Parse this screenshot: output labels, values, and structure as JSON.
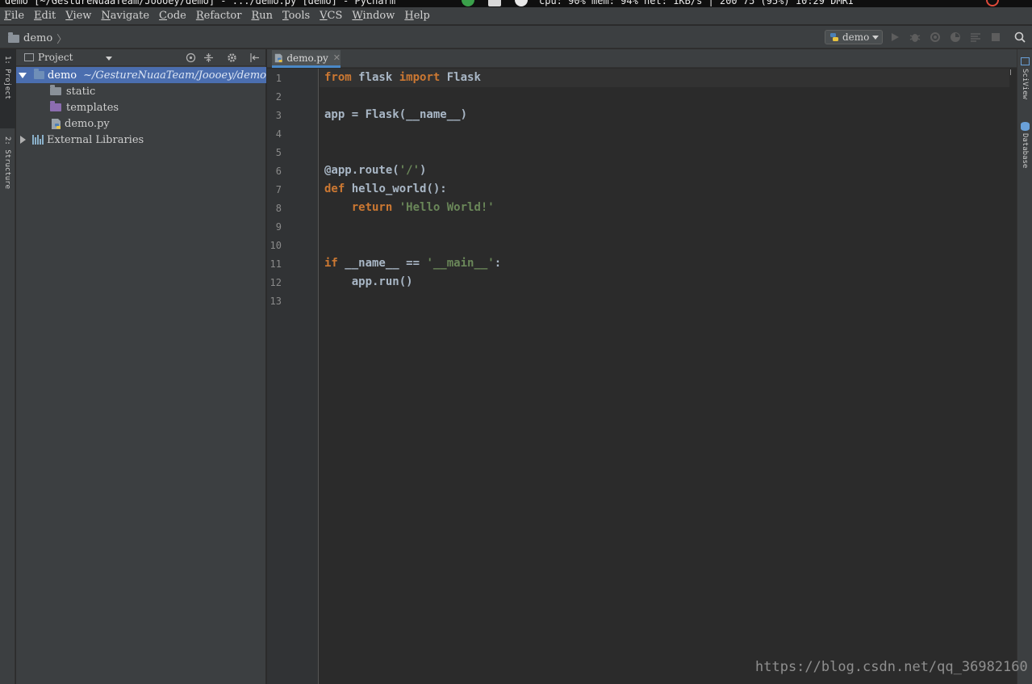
{
  "system_bar": {
    "window_title": "demo [~/GestureNuaaTeam/Joooey/demo] - .../demo.py [demo] - PyCharm",
    "status_text": "cpu: 90% mem: 94% net:    1KB/s | 200  75        (95%)     10:29   DMRI"
  },
  "menu": {
    "items": [
      {
        "mnemonic": "F",
        "rest": "ile"
      },
      {
        "mnemonic": "E",
        "rest": "dit"
      },
      {
        "mnemonic": "V",
        "rest": "iew"
      },
      {
        "mnemonic": "N",
        "rest": "avigate"
      },
      {
        "mnemonic": "C",
        "rest": "ode"
      },
      {
        "mnemonic": "R",
        "rest": "efactor"
      },
      {
        "mnemonic": "R",
        "rest": "un"
      },
      {
        "mnemonic": "T",
        "rest": "ools"
      },
      {
        "mnemonic": "V",
        "rest": "CS"
      },
      {
        "mnemonic": "W",
        "rest": "indow"
      },
      {
        "mnemonic": "H",
        "rest": "elp"
      }
    ]
  },
  "navbar": {
    "breadcrumb": "demo",
    "run_config": "demo"
  },
  "left_strip": {
    "tab1": "1: Project",
    "tab2": "2: Structure"
  },
  "project_panel": {
    "title": "Project",
    "tree": {
      "root_name": "demo",
      "root_path": "~/GestureNuaaTeam/Joooey/demo",
      "child_static": "static",
      "child_templates": "templates",
      "child_file": "demo.py",
      "external": "External Libraries"
    }
  },
  "editor": {
    "tab_label": "demo.py",
    "line_numbers": [
      "1",
      "2",
      "3",
      "4",
      "5",
      "6",
      "7",
      "8",
      "9",
      "10",
      "11",
      "12",
      "13"
    ],
    "code": {
      "l1_kw1": "from",
      "l1_mod": " flask ",
      "l1_kw2": "import",
      "l1_name": " Flask",
      "l3": "app = Flask(__name__)",
      "l6_a": "@app.route(",
      "l6_str": "'/'",
      "l6_b": ")",
      "l7_kw": "def",
      "l7_rest": " hello_world():",
      "l8_kw": "    return",
      "l8_sp": " ",
      "l8_str": "'Hello World!'",
      "l11_kw": "if",
      "l11_mid": " __name__ == ",
      "l11_str": "'__main__'",
      "l11_end": ":",
      "l12": "    app.run()"
    }
  },
  "right_strip": {
    "tab1": "SciView",
    "tab2": "Database"
  },
  "watermark": "https://blog.csdn.net/qq_36982160",
  "colors": {
    "selection": "#4b6eaf",
    "keyword": "#cc7832",
    "string": "#6a8759",
    "identifier": "#a9b7c6",
    "background": "#2b2b2b",
    "panel": "#3c3f41"
  }
}
